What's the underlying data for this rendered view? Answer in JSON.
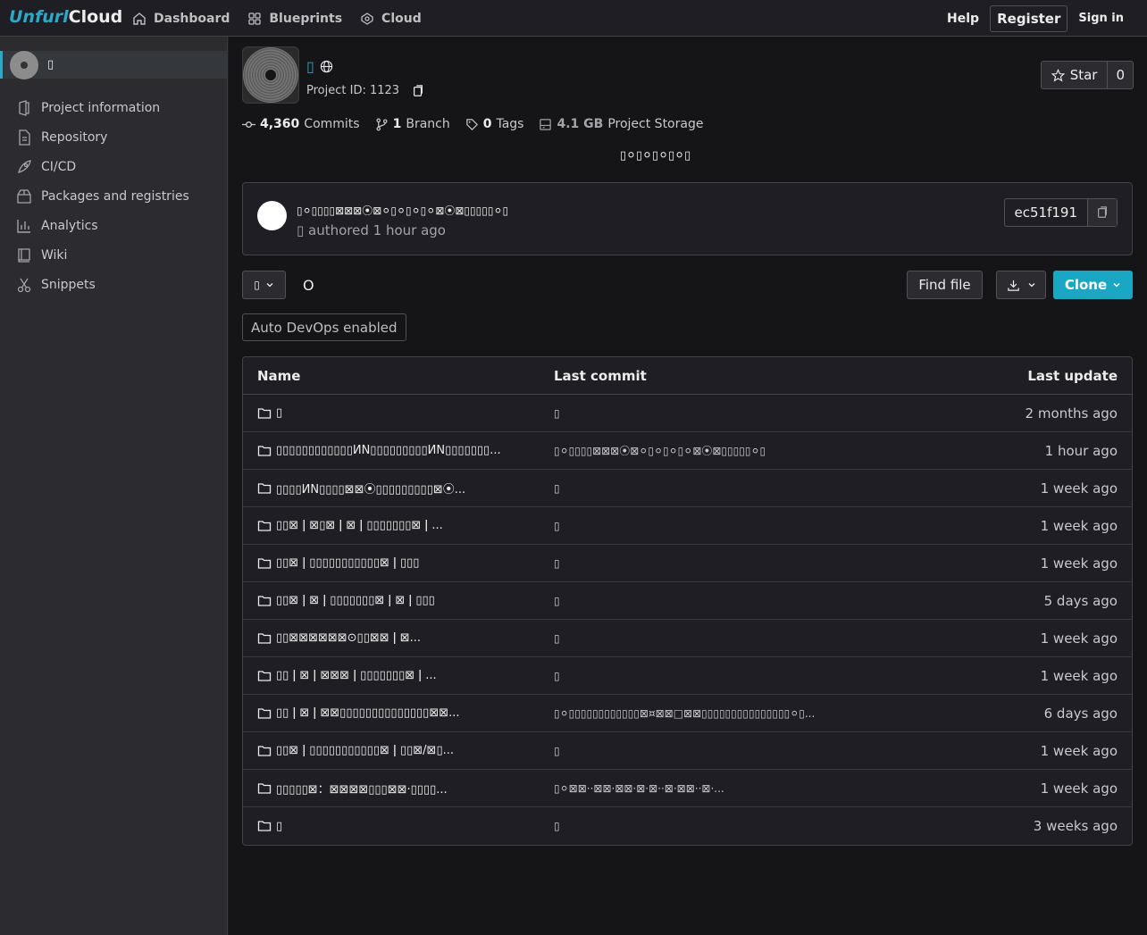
{
  "topbar": {
    "logo_u": "Unfurl",
    "logo_c": "Cloud",
    "nav": [
      {
        "label": "Dashboard",
        "icon": "home-icon"
      },
      {
        "label": "Blueprints",
        "icon": "grid-icon"
      },
      {
        "label": "Cloud",
        "icon": "cloud-icon"
      }
    ],
    "help": "Help",
    "register": "Register",
    "signin": "Sign in"
  },
  "sidebar": {
    "project_name": "▯",
    "items": [
      {
        "label": "Project information",
        "icon": "project-icon"
      },
      {
        "label": "Repository",
        "icon": "document-icon"
      },
      {
        "label": "CI/CD",
        "icon": "rocket-icon"
      },
      {
        "label": "Packages and registries",
        "icon": "package-icon"
      },
      {
        "label": "Analytics",
        "icon": "chart-icon"
      },
      {
        "label": "Wiki",
        "icon": "book-icon"
      },
      {
        "label": "Snippets",
        "icon": "scissors-icon"
      }
    ]
  },
  "project": {
    "title": "▯",
    "id_label": "Project ID: 1123",
    "star_label": "Star",
    "star_count": "0",
    "stats": {
      "commits_num": "4,360",
      "commits_label": "Commits",
      "branch_num": "1",
      "branch_label": "Branch",
      "tags_num": "0",
      "tags_label": "Tags",
      "storage_num": "4.1 GB",
      "storage_label": "Project Storage"
    },
    "description": "▯⚪▯⚪▯⚪▯⚪▯"
  },
  "commit": {
    "title": "▯⚪▯▯▯▯⊠⊠⊠⦿⊠⚪▯⚪▯⚪▯⚪⊠⦿⊠▯▯▯▯▯⚪▯",
    "meta": "▯ authored 1 hour ago",
    "sha": "ec51f191"
  },
  "controls": {
    "branch": "▯",
    "path": "O",
    "find_file": "Find file",
    "clone": "Clone",
    "auto_devops": "Auto DevOps enabled"
  },
  "table": {
    "headers": {
      "name": "Name",
      "commit": "Last commit",
      "update": "Last update"
    },
    "rows": [
      {
        "name": "▯",
        "commit": "▯",
        "update": "2 months ago"
      },
      {
        "name": "▯▯▯▯▯▯▯▯▯▯▯▯ИN▯▯▯▯▯▯▯▯▯ИN▯▯▯▯▯▯▯...",
        "commit": "▯⚪▯▯▯▯⊠⊠⊠⦿⊠⚪▯⚪▯⚪▯⚪⊠⦿⊠▯▯▯▯▯⚪▯",
        "update": "1 hour ago"
      },
      {
        "name": "▯▯▯▯ИN▯▯▯▯⊠⊠⦿▯▯▯▯▯▯▯▯▯⊠⦿...",
        "commit": "▯",
        "update": "1 week ago"
      },
      {
        "name": "▯▯⊠ ǀ ⊠▯⊠ ǀ ⊠ ǀ ▯▯▯▯▯▯▯⊠ ǀ ...",
        "commit": "▯",
        "update": "1 week ago"
      },
      {
        "name": "▯▯⊠ ǀ ▯▯▯▯▯▯▯▯▯▯▯⊠ ǀ ▯▯▯",
        "commit": "▯",
        "update": "1 week ago"
      },
      {
        "name": "▯▯⊠ ǀ ⊠ ǀ ▯▯▯▯▯▯▯⊠ ǀ ⊠ ǀ ▯▯▯",
        "commit": "▯",
        "update": "5 days ago"
      },
      {
        "name": "▯▯⊠⊠⊠⊠⊠⊠⊙▯▯⊠⊠ ǀ ⊠...",
        "commit": "▯",
        "update": "1 week ago"
      },
      {
        "name": "▯▯ ǀ ⊠ ǀ ⊠⊠⊠ ǀ ▯▯▯▯▯▯▯⊠ ǀ ...",
        "commit": "▯",
        "update": "1 week ago"
      },
      {
        "name": "▯▯ ǀ ⊠ ǀ ⊠⊠▯▯▯▯▯▯▯▯▯▯▯▯▯▯⊠⊠...",
        "commit": "▯⚪▯▯▯▯▯▯▯▯▯▯▯▯⊠¤⊠⊠□⊠⊠▯▯▯▯▯▯▯▯▯▯▯▯▯▯▯⚪▯...",
        "update": "6 days ago"
      },
      {
        "name": "▯▯⊠ ǀ ▯▯▯▯▯▯▯▯▯▯▯⊠ ǀ ▯▯⊠/⊠▯...",
        "commit": "▯",
        "update": "1 week ago"
      },
      {
        "name": "▯▯▯▯▯⊠：⊠⊠⊠⊠▯▯▯⊠⊠·▯▯▯▯...",
        "commit": "▯⚪⊠⊠··⊠⊠·⊠⊠·⊠·⊠··⊠·⊠⊠··⊠·...",
        "update": "1 week ago"
      },
      {
        "name": "▯",
        "commit": "▯",
        "update": "3 weeks ago"
      }
    ]
  }
}
